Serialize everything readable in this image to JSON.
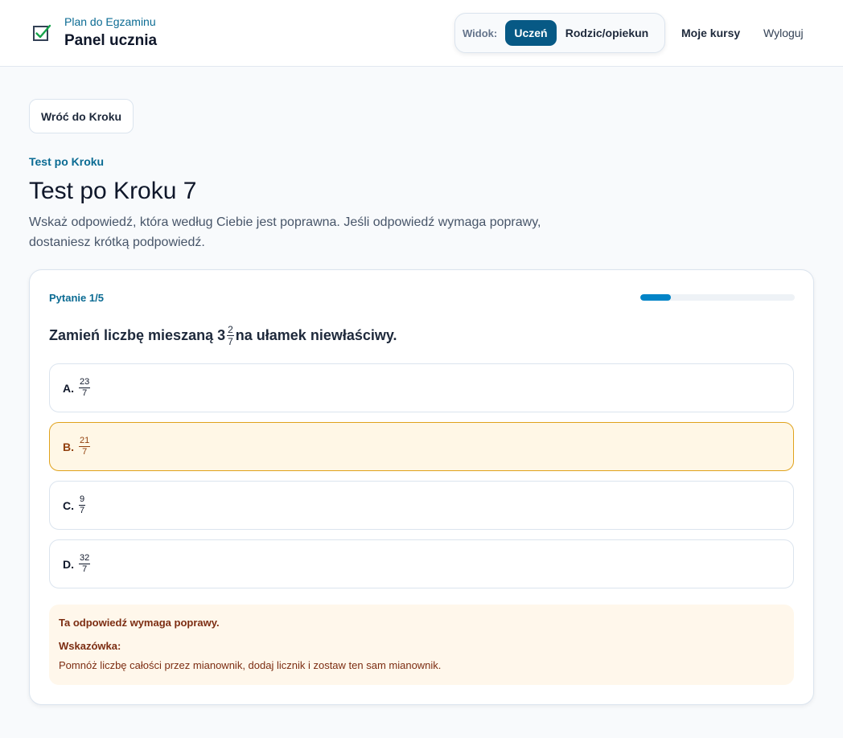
{
  "header": {
    "brand_sub": "Plan do Egzaminu",
    "brand_title": "Panel ucznia",
    "logo_icon": "checkbox-checked-icon",
    "view_switch": {
      "label": "Widok:",
      "options": [
        "Uczeń",
        "Rodzic/opiekun"
      ],
      "selected": "Uczeń"
    },
    "nav": {
      "courses": "Moje kursy",
      "logout": "Wyloguj"
    }
  },
  "back_button": "Wróć do Kroku",
  "eyebrow": "Test po Kroku",
  "title": "Test po Kroku 7",
  "description": "Wskaż odpowiedź, która według Ciebie jest poprawna. Jeśli odpowiedź wymaga poprawy, dostaniesz krótką podpowiedź.",
  "quiz": {
    "counter": "Pytanie 1/5",
    "progress": 0.2,
    "question": {
      "before": "Zamień liczbę mieszaną 3",
      "frac_num": "2",
      "frac_den": "7",
      "after": "na ułamek niewłaściwy."
    },
    "options": [
      {
        "letter": "A.",
        "num": "23",
        "den": "7",
        "selected": false
      },
      {
        "letter": "B.",
        "num": "21",
        "den": "7",
        "selected": true
      },
      {
        "letter": "C.",
        "num": "9",
        "den": "7",
        "selected": false
      },
      {
        "letter": "D.",
        "num": "32",
        "den": "7",
        "selected": false
      }
    ],
    "feedback": {
      "heading": "Ta odpowiedź wymaga poprawy.",
      "hint_label": "Wskazówka:",
      "hint_text": "Pomnóż liczbę całości przez mianownik, dodaj licznik i zostaw ten sam mianownik."
    }
  },
  "colors": {
    "accent": "#075985",
    "link": "#0b6b93",
    "selected_bg": "#fff7e6",
    "selected_border": "#e0a21b",
    "hint_bg": "#fff7eb"
  }
}
